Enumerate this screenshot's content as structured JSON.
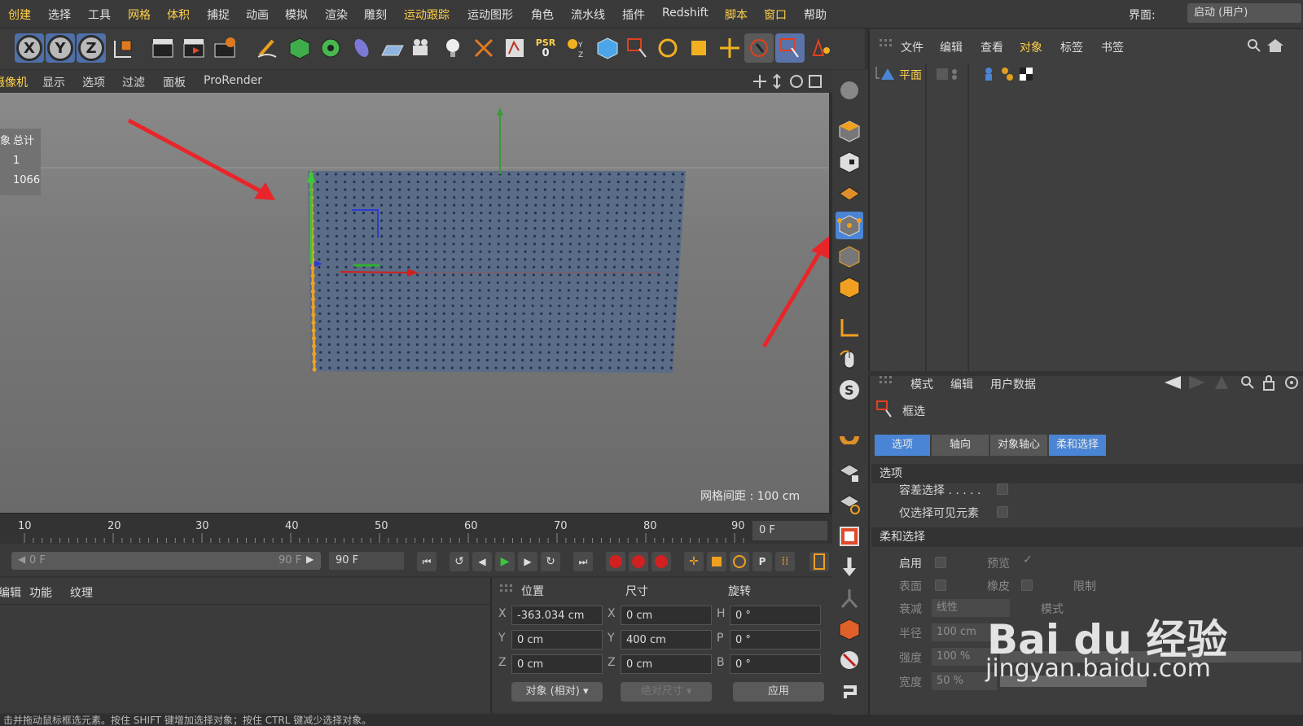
{
  "menu": {
    "items": [
      "创建",
      "选择",
      "工具",
      "网格",
      "体积",
      "捕捉",
      "动画",
      "模拟",
      "渲染",
      "雕刻",
      "运动跟踪",
      "运动图形",
      "角色",
      "流水线",
      "插件",
      "Redshift",
      "脚本",
      "窗口",
      "帮助"
    ],
    "interface_label": "界面:",
    "interface_value": "启动 (用户)"
  },
  "toolbar": {
    "axis_x": "X",
    "axis_y": "Y",
    "axis_z": "Z",
    "psr_label": "PSR",
    "psr_value": "0"
  },
  "viewport": {
    "menu": [
      "摄像机",
      "显示",
      "选项",
      "过滤",
      "面板",
      "ProRender"
    ],
    "stats": {
      "header_fragment": "象",
      "header_total": "总计",
      "objects": "1",
      "points": "1066"
    },
    "grid_spacing": "网格间距 : 100 cm"
  },
  "object_manager": {
    "menu": [
      "文件",
      "编辑",
      "查看",
      "对象",
      "标签",
      "书签"
    ],
    "object_name": "平面"
  },
  "attributes": {
    "menu": [
      "模式",
      "编辑",
      "用户数据"
    ],
    "tool_name": "框选",
    "tabs": [
      "选项",
      "轴向",
      "对象轴心",
      "柔和选择"
    ],
    "section_options": "选项",
    "opt_tolerance": "容差选择 . . . . .",
    "opt_visible_only": "仅选择可见元素",
    "section_soft": "柔和选择",
    "soft_enable": "启用",
    "soft_preview": "预览",
    "soft_surface": "表面",
    "soft_rubber": "橡皮",
    "soft_limit": "限制",
    "soft_mode": "模式",
    "soft_falloff_label": "衰减",
    "soft_falloff_value": "线性",
    "soft_radius_label": "半径",
    "soft_radius_value": "100 cm",
    "soft_strength_label": "强度",
    "soft_strength_value": "100 %",
    "soft_width_label": "宽度",
    "soft_width_value": "50 %"
  },
  "timeline": {
    "ticks": [
      "10",
      "20",
      "30",
      "40",
      "50",
      "60",
      "70",
      "80",
      "90"
    ],
    "current_frame": "0 F",
    "range_start": "0 F",
    "range_end": "90 F",
    "end_frame": "90 F"
  },
  "material_manager": {
    "menu": [
      "编辑",
      "功能",
      "纹理"
    ]
  },
  "coordinates": {
    "headers": [
      "位置",
      "尺寸",
      "旋转"
    ],
    "pos": {
      "x": "-363.034 cm",
      "y": "0 cm",
      "z": "0 cm"
    },
    "size": {
      "x": "0 cm",
      "y": "400 cm",
      "z": "0 cm"
    },
    "rot": {
      "h": "0 °",
      "p": "0 °",
      "b": "0 °"
    },
    "labels": {
      "x": "X",
      "y": "Y",
      "z": "Z",
      "h": "H",
      "p": "P",
      "b": "B"
    },
    "mode_object": "对象 (相对)",
    "mode_size": "绝对尺寸",
    "apply": "应用"
  },
  "status_bar": "击并拖动鼠标框选元素。按住 SHIFT 键增加选择对象；按住 CTRL 键减少选择对象。",
  "watermark": {
    "logo": "Bai du 经验",
    "url": "jingyan.baidu.com"
  },
  "colors": {
    "accent_yellow": "#ffd04a",
    "arrow_red": "#e8262a",
    "mesh_blue": "#3b5f95",
    "tab_active": "#4a84d4"
  }
}
